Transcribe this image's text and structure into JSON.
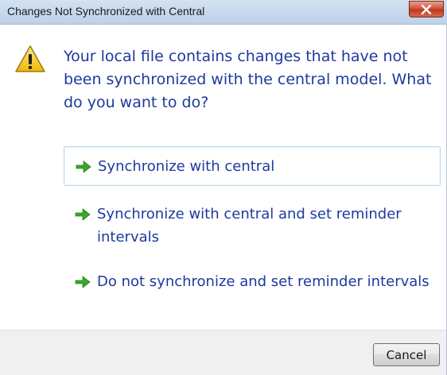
{
  "window": {
    "title": "Changes Not Synchronized with Central"
  },
  "message": {
    "icon": "warning-icon",
    "text": "Your local file contains changes that have not been synchronized with the central model. What do you want to do?"
  },
  "commands": [
    {
      "label": "Synchronize with central",
      "icon": "green-arrow-icon",
      "focused": true
    },
    {
      "label": "Synchronize with central and set reminder intervals",
      "icon": "green-arrow-icon",
      "focused": false
    },
    {
      "label": "Do not synchronize and set reminder intervals",
      "icon": "green-arrow-icon",
      "focused": false
    }
  ],
  "footer": {
    "cancel_label": "Cancel"
  },
  "colors": {
    "instruction_text": "#1d3a9e",
    "arrow": "#3aa72c",
    "warning": "#f5c211",
    "close_button": "#c2361c"
  }
}
